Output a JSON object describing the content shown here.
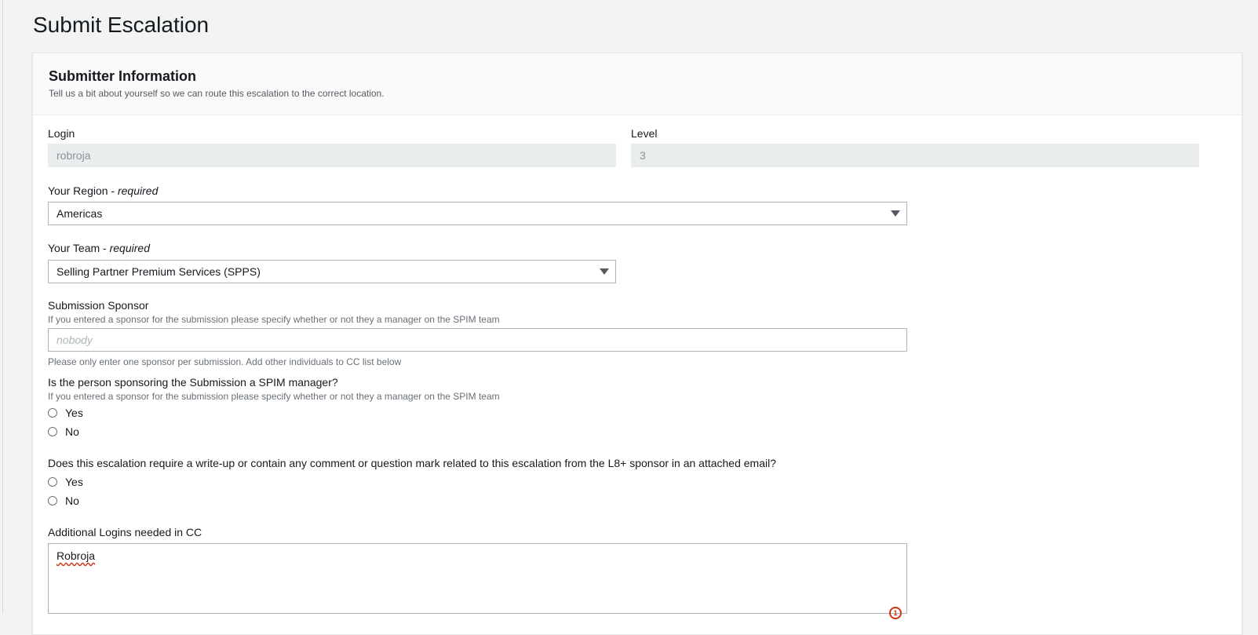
{
  "page": {
    "title": "Submit Escalation"
  },
  "panel": {
    "title": "Submitter Information",
    "description": "Tell us a bit about yourself so we can route this escalation to the correct location."
  },
  "form": {
    "login": {
      "label": "Login",
      "value": "robroja"
    },
    "level": {
      "label": "Level",
      "value": "3"
    },
    "region": {
      "label": "Your Region - ",
      "required": "required",
      "value": "Americas"
    },
    "team": {
      "label": "Your Team - ",
      "required": "required",
      "value": "Selling Partner Premium Services (SPPS)"
    },
    "sponsor": {
      "label": "Submission Sponsor",
      "hint": "If you entered a sponsor for the submission please specify whether or not they a manager on the SPIM team",
      "placeholder": "nobody",
      "footnote": "Please only enter one sponsor per submission. Add other individuals to CC list below"
    },
    "spim_manager": {
      "question": "Is the person sponsoring the Submission a SPIM manager?",
      "hint": "If you entered a sponsor for the submission please specify whether or not they a manager on the SPIM team",
      "options": [
        "Yes",
        "No"
      ]
    },
    "writeup": {
      "question": "Does this escalation require a write-up or contain any comment or question mark related to this escalation from the L8+ sponsor in an attached email?",
      "options": [
        "Yes",
        "No"
      ]
    },
    "cc": {
      "label": "Additional Logins needed in CC",
      "value": "Robroja",
      "grammar_count": "1"
    }
  }
}
